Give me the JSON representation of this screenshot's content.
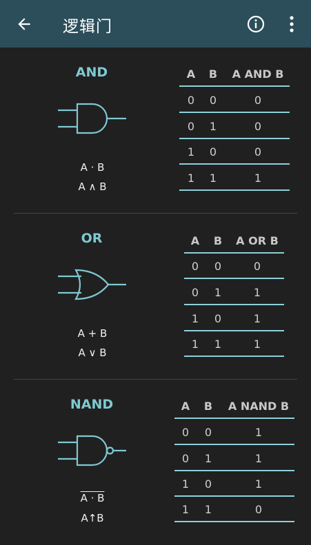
{
  "appbar": {
    "title": "逻辑门",
    "back_icon": "arrow-left-icon",
    "info_icon": "info-circle-icon",
    "more_icon": "more-vert-icon"
  },
  "colors": {
    "appbar": "#2b4e5a",
    "background": "#202020",
    "accent": "#7fc9d2"
  },
  "gates": [
    {
      "name": "AND",
      "expr1": "A · B",
      "expr2": "A ∧ B",
      "table": {
        "headers": [
          "A",
          "B",
          "A AND B"
        ],
        "rows": [
          [
            "0",
            "0",
            "0"
          ],
          [
            "0",
            "1",
            "0"
          ],
          [
            "1",
            "0",
            "0"
          ],
          [
            "1",
            "1",
            "1"
          ]
        ]
      }
    },
    {
      "name": "OR",
      "expr1": "A + B",
      "expr2": "A ∨ B",
      "table": {
        "headers": [
          "A",
          "B",
          "A OR B"
        ],
        "rows": [
          [
            "0",
            "0",
            "0"
          ],
          [
            "0",
            "1",
            "1"
          ],
          [
            "1",
            "0",
            "1"
          ],
          [
            "1",
            "1",
            "1"
          ]
        ]
      }
    },
    {
      "name": "NAND",
      "expr1": "A · B",
      "expr2": "A↑B",
      "table": {
        "headers": [
          "A",
          "B",
          "A NAND B"
        ],
        "rows": [
          [
            "0",
            "0",
            "1"
          ],
          [
            "0",
            "1",
            "1"
          ],
          [
            "1",
            "0",
            "1"
          ],
          [
            "1",
            "1",
            "0"
          ]
        ]
      }
    }
  ]
}
